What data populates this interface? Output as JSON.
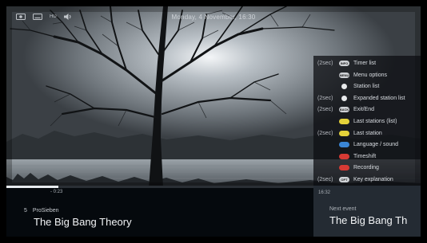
{
  "topbar": {
    "date_time": "Monday, 4 November, 16:30",
    "icons": [
      "recording-icon",
      "subtitles-icon",
      "video-format-icon",
      "volume-icon"
    ],
    "format_label": "HD"
  },
  "keys": [
    {
      "hint": "(2sec)",
      "button": "INFO",
      "color": "gray",
      "label": "Timer list"
    },
    {
      "hint": "",
      "button": "MENU",
      "color": "gray",
      "label": "Menu options"
    },
    {
      "hint": "",
      "button": "",
      "color": "dot",
      "label": "Station list"
    },
    {
      "hint": "(2sec)",
      "button": "",
      "color": "dot",
      "label": "Expanded station list"
    },
    {
      "hint": "(2sec)",
      "button": "BACK",
      "color": "gray",
      "label": "Exit/End"
    },
    {
      "hint": "",
      "button": "",
      "color": "yellow",
      "label": "Last stations (list)"
    },
    {
      "hint": "(2sec)",
      "button": "",
      "color": "yellow",
      "label": "Last station"
    },
    {
      "hint": "",
      "button": "",
      "color": "blue",
      "label": "Language / sound"
    },
    {
      "hint": "",
      "button": "",
      "color": "red",
      "label": "Timeshift"
    },
    {
      "hint": "",
      "button": "",
      "color": "red",
      "label": "Recording"
    },
    {
      "hint": "(2sec)",
      "button": "OPT",
      "color": "gray",
      "label": "Key explanation"
    }
  ],
  "current": {
    "elapsed": "- 0:23",
    "progress_fraction": 0.17,
    "channel_number": "5",
    "channel_name": "ProSieben",
    "title": "The Big Bang Theory"
  },
  "next": {
    "time": "16:32",
    "label": "Next event",
    "title": "The Big Bang Th"
  }
}
